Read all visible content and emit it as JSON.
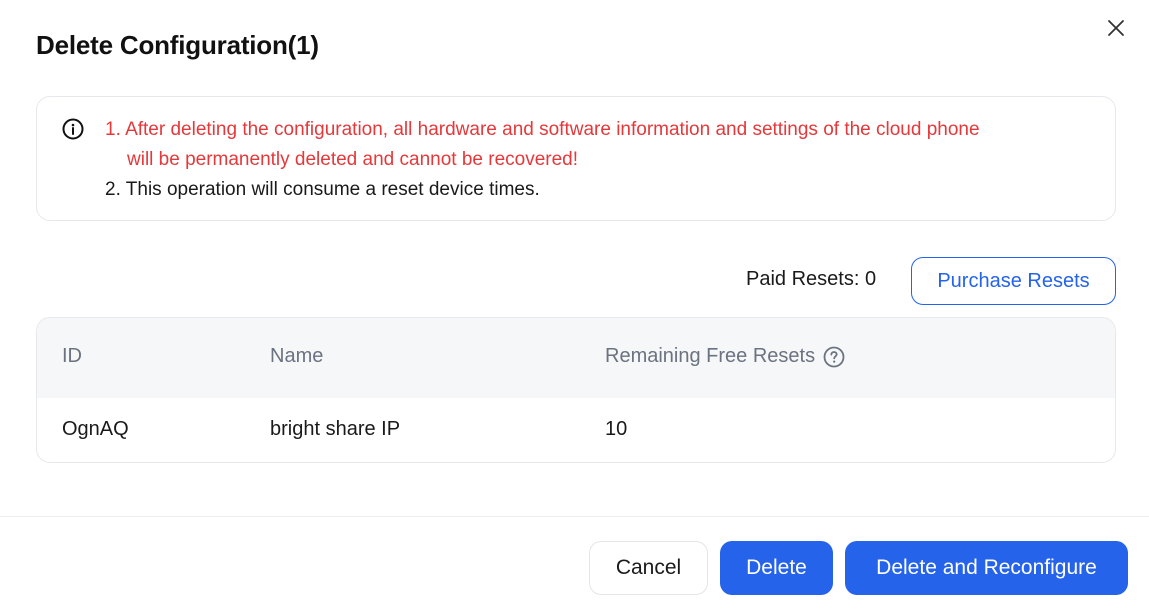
{
  "dialog": {
    "title": "Delete Configuration(1)",
    "close_icon": "close-icon"
  },
  "notice": {
    "icon": "info-icon",
    "line1": "1. After deleting the configuration, all hardware and software information and settings of the cloud phone",
    "line1_cont": "will be permanently deleted and cannot be recovered!",
    "line2": "2. This operation will consume a reset device times.",
    "warning_color": "#e5383b"
  },
  "resets": {
    "paid_label": "Paid Resets: 0",
    "purchase_label": "Purchase Resets"
  },
  "table": {
    "columns": [
      "ID",
      "Name",
      "Remaining Free Resets"
    ],
    "help_icon": "question-circle-icon",
    "rows": [
      [
        "OgnAQ",
        "bright share IP",
        "10"
      ]
    ]
  },
  "footer": {
    "cancel_label": "Cancel",
    "delete_label": "Delete",
    "reconfigure_label": "Delete and Reconfigure"
  },
  "colors": {
    "accent": "#2563eb",
    "header_bg": "#f6f7f8",
    "border": "#e6e8eb"
  }
}
